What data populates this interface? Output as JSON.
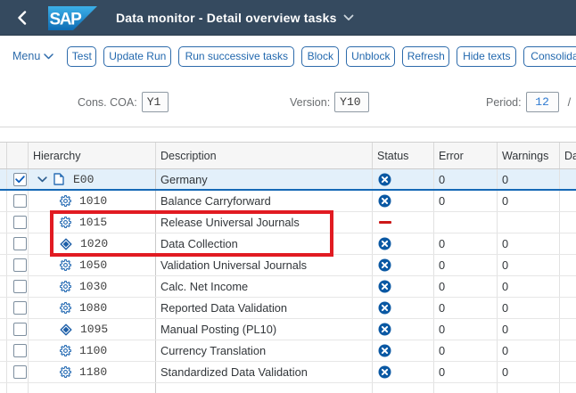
{
  "shellbar": {
    "title": "Data monitor - Detail overview tasks",
    "logo_text": "SAP"
  },
  "toolbar": {
    "menu_label": "Menu",
    "buttons": [
      "Test",
      "Update Run",
      "Run successive tasks",
      "Block",
      "Unblock",
      "Refresh",
      "Hide texts",
      "Consolidation monitor"
    ]
  },
  "filters": [
    {
      "label": "Cons. COA:",
      "value": "Y1"
    },
    {
      "label": "Version:",
      "value": "Y10"
    },
    {
      "label": "Period:",
      "value": "12",
      "suffix": "/"
    }
  ],
  "table": {
    "columns": [
      "Hierarchy",
      "Description",
      "Status",
      "Error",
      "Warnings",
      "Date"
    ],
    "rows": [
      {
        "level": 0,
        "expander": true,
        "checked": true,
        "selected": true,
        "icon": "doc",
        "id": "E00",
        "description": "Germany",
        "status": "error",
        "error": "0",
        "warnings": "0"
      },
      {
        "level": 1,
        "expander": false,
        "checked": false,
        "selected": false,
        "icon": "gear",
        "id": "1010",
        "description": "Balance Carryforward",
        "status": "error",
        "error": "0",
        "warnings": "0"
      },
      {
        "level": 1,
        "expander": false,
        "checked": false,
        "selected": false,
        "icon": "gear",
        "id": "1015",
        "description": "Release Universal Journals",
        "status": "dash",
        "error": "",
        "warnings": ""
      },
      {
        "level": 1,
        "expander": false,
        "checked": false,
        "selected": false,
        "icon": "diamond",
        "id": "1020",
        "description": "Data Collection",
        "status": "error",
        "error": "0",
        "warnings": "0"
      },
      {
        "level": 1,
        "expander": false,
        "checked": false,
        "selected": false,
        "icon": "gear",
        "id": "1050",
        "description": "Validation Universal Journals",
        "status": "error",
        "error": "0",
        "warnings": "0"
      },
      {
        "level": 1,
        "expander": false,
        "checked": false,
        "selected": false,
        "icon": "gear",
        "id": "1030",
        "description": "Calc. Net Income",
        "status": "error",
        "error": "0",
        "warnings": "0"
      },
      {
        "level": 1,
        "expander": false,
        "checked": false,
        "selected": false,
        "icon": "gear",
        "id": "1080",
        "description": "Reported Data Validation",
        "status": "error",
        "error": "0",
        "warnings": "0"
      },
      {
        "level": 1,
        "expander": false,
        "checked": false,
        "selected": false,
        "icon": "diamond",
        "id": "1095",
        "description": "Manual Posting (PL10)",
        "status": "error",
        "error": "0",
        "warnings": "0"
      },
      {
        "level": 1,
        "expander": false,
        "checked": false,
        "selected": false,
        "icon": "gear",
        "id": "1100",
        "description": "Currency Translation",
        "status": "error",
        "error": "0",
        "warnings": "0"
      },
      {
        "level": 1,
        "expander": false,
        "checked": false,
        "selected": false,
        "icon": "gear",
        "id": "1180",
        "description": "Standardized Data Validation",
        "status": "error",
        "error": "0",
        "warnings": "0"
      }
    ],
    "icons": {
      "doc": "document-icon",
      "gear": "gear-icon",
      "diamond": "diamond-milestone-icon",
      "error": "error-circle-icon",
      "dash": "red-dash-icon"
    }
  },
  "annotation": {
    "shape": "rectangle",
    "color": "#e11b22",
    "highlighted_rows": [
      "1015",
      "1020"
    ]
  },
  "colors": {
    "shellbar_background": "#354a5f",
    "button_blue": "#2d6bab",
    "selected_row_background": "#e3f0fa",
    "selected_row_border": "#1569b6",
    "status_error_blue": "#0a58a3",
    "status_dash_red": "#cc1717",
    "logo_gradient_top": "#3cb0e8",
    "logo_gradient_bottom": "#0e6cb4"
  }
}
